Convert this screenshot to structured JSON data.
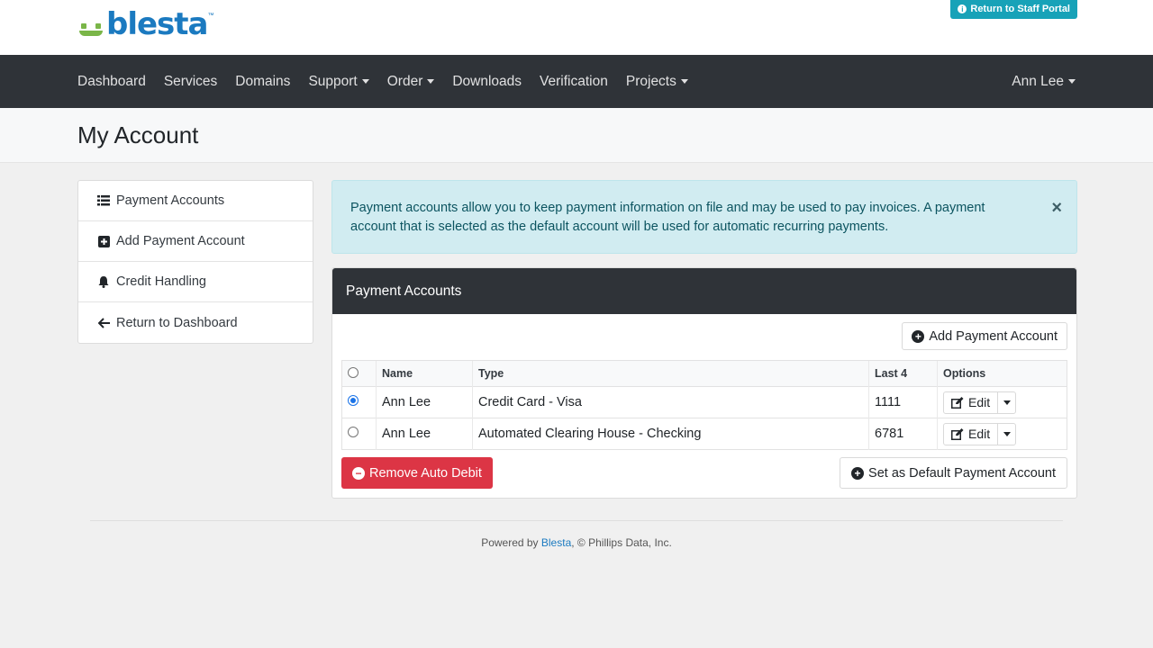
{
  "brand": {
    "name": "blesta",
    "tm": "™"
  },
  "top": {
    "staff_portal": "Return to Staff Portal"
  },
  "nav": {
    "items": [
      {
        "label": "Dashboard",
        "dropdown": false
      },
      {
        "label": "Services",
        "dropdown": false
      },
      {
        "label": "Domains",
        "dropdown": false
      },
      {
        "label": "Support",
        "dropdown": true
      },
      {
        "label": "Order",
        "dropdown": true
      },
      {
        "label": "Downloads",
        "dropdown": false
      },
      {
        "label": "Verification",
        "dropdown": false
      },
      {
        "label": "Projects",
        "dropdown": true
      }
    ],
    "user": "Ann Lee"
  },
  "page": {
    "title": "My Account"
  },
  "sidebar": {
    "items": [
      {
        "label": "Payment Accounts",
        "icon": "list-icon"
      },
      {
        "label": "Add Payment Account",
        "icon": "plus-square-icon"
      },
      {
        "label": "Credit Handling",
        "icon": "bell-icon"
      },
      {
        "label": "Return to Dashboard",
        "icon": "arrow-left-icon"
      }
    ]
  },
  "alert": {
    "text": "Payment accounts allow you to keep payment information on file and may be used to pay invoices. A payment account that is selected as the default account will be used for automatic recurring payments.",
    "close": "×"
  },
  "card": {
    "title": "Payment Accounts",
    "add_label": "Add Payment Account",
    "columns": [
      "Name",
      "Type",
      "Last 4",
      "Options"
    ],
    "rows": [
      {
        "name": "Ann Lee",
        "type": "Credit Card - Visa",
        "last4": "1111",
        "selected": true,
        "edit": "Edit"
      },
      {
        "name": "Ann Lee",
        "type": "Automated Clearing House - Checking",
        "last4": "6781",
        "selected": false,
        "edit": "Edit"
      }
    ],
    "remove_label": "Remove Auto Debit",
    "default_label": "Set as Default Payment Account"
  },
  "footer": {
    "prefix": "Powered by ",
    "link": "Blesta",
    "suffix": ", © Phillips Data, Inc."
  },
  "colors": {
    "accent": "#17a2b8",
    "nav_bg": "#2f3338",
    "danger": "#dc3545",
    "brand_blue": "#1b7ac0",
    "brand_green": "#7ab648"
  }
}
